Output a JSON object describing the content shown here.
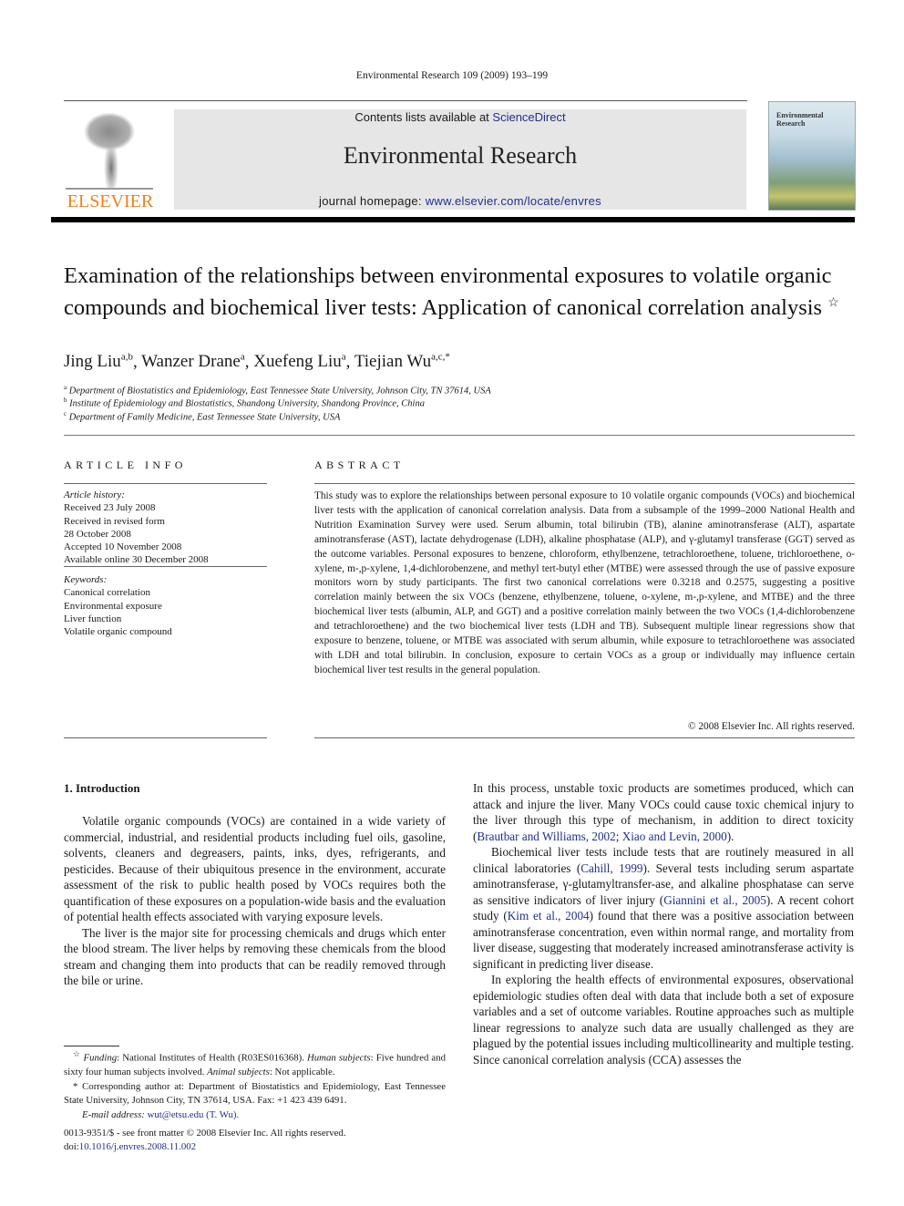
{
  "running_head": "Environmental Research 109 (2009) 193–199",
  "masthead": {
    "publisher_logo_text": "ELSEVIER",
    "contents_prefix": "Contents lists available at ",
    "contents_link": "ScienceDirect",
    "journal_title": "Environmental Research",
    "homepage_prefix": "journal homepage: ",
    "homepage_link": "www.elsevier.com/locate/envres",
    "cover_title_line1": "Environmental",
    "cover_title_line2": "Research",
    "colors": {
      "logo_orange": "#f07f1a",
      "masthead_bg": "#e6e6e6",
      "link": "#1f2f8f"
    }
  },
  "article": {
    "title": "Examination of the relationships between environmental exposures to volatile organic compounds and biochemical liver tests: Application of canonical correlation analysis",
    "title_note_mark": "☆",
    "authors": [
      {
        "name": "Jing Liu",
        "aff": "a,b",
        "sep": ", "
      },
      {
        "name": "Wanzer Drane",
        "aff": "a",
        "sep": ", "
      },
      {
        "name": "Xuefeng Liu",
        "aff": "a",
        "sep": ", "
      },
      {
        "name": "Tiejian Wu",
        "aff": "a,c,*",
        "sep": ""
      }
    ],
    "affiliations": [
      {
        "mark": "a",
        "text": "Department of Biostatistics and Epidemiology, East Tennessee State University, Johnson City, TN 37614, USA"
      },
      {
        "mark": "b",
        "text": "Institute of Epidemiology and Biostatistics, Shandong University, Shandong Province, China"
      },
      {
        "mark": "c",
        "text": "Department of Family Medicine, East Tennessee State University, USA"
      }
    ]
  },
  "article_info": {
    "heading": "ARTICLE INFO",
    "history_label": "Article history:",
    "history": [
      "Received 23 July 2008",
      "Received in revised form",
      "28 October 2008",
      "Accepted 10 November 2008",
      "Available online 30 December 2008"
    ],
    "keywords_label": "Keywords:",
    "keywords": [
      "Canonical correlation",
      "Environmental exposure",
      "Liver function",
      "Volatile organic compound"
    ]
  },
  "abstract": {
    "heading": "ABSTRACT",
    "text": "This study was to explore the relationships between personal exposure to 10 volatile organic compounds (VOCs) and biochemical liver tests with the application of canonical correlation analysis. Data from a subsample of the 1999–2000 National Health and Nutrition Examination Survey were used. Serum albumin, total bilirubin (TB), alanine aminotransferase (ALT), aspartate aminotransferase (AST), lactate dehydrogenase (LDH), alkaline phosphatase (ALP), and γ-glutamyl transferase (GGT) served as the outcome variables. Personal exposures to benzene, chloroform, ethylbenzene, tetrachloroethene, toluene, trichloroethene, o-xylene, m-,p-xylene, 1,4-dichlorobenzene, and methyl tert-butyl ether (MTBE) were assessed through the use of passive exposure monitors worn by study participants. The first two canonical correlations were 0.3218 and 0.2575, suggesting a positive correlation mainly between the six VOCs (benzene, ethylbenzene, toluene, o-xylene, m-,p-xylene, and MTBE) and the three biochemical liver tests (albumin, ALP, and GGT) and a positive correlation mainly between the two VOCs (1,4-dichlorobenzene and tetrachloroethene) and the two biochemical liver tests (LDH and TB). Subsequent multiple linear regressions show that exposure to benzene, toluene, or MTBE was associated with serum albumin, while exposure to tetrachloroethene was associated with LDH and total bilirubin. In conclusion, exposure to certain VOCs as a group or individually may influence certain biochemical liver test results in the general population.",
    "copyright": "© 2008 Elsevier Inc. All rights reserved."
  },
  "introduction": {
    "heading": "1.  Introduction",
    "left_paragraphs": [
      "Volatile organic compounds (VOCs) are contained in a wide variety of commercial, industrial, and residential products including fuel oils, gasoline, solvents, cleaners and degreasers, paints, inks, dyes, refrigerants, and pesticides. Because of their ubiquitous presence in the environment, accurate assessment of the risk to public health posed by VOCs requires both the quantification of these exposures on a population-wide basis and the evaluation of potential health effects associated with varying exposure levels.",
      "The liver is the major site for processing chemicals and drugs which enter the blood stream. The liver helps by removing these chemicals from the blood stream and changing them into products that can be readily removed through the bile or urine."
    ],
    "right": {
      "p1_text": "In this process, unstable toxic products are sometimes produced, which can attack and injure the liver. Many VOCs could cause toxic chemical injury to the liver through this type of mechanism, in addition to direct toxicity (",
      "p1_cite1": "Brautbar and Williams, 2002",
      "p1_sep": "; ",
      "p1_cite2": "Xiao and Levin, 2000",
      "p1_end": ").",
      "p2_a": "Biochemical liver tests include tests that are routinely measured in all clinical laboratories (",
      "p2_cite1": "Cahill, 1999",
      "p2_b": "). Several tests including serum aspartate aminotransferase, γ-glutamyltransfer-ase, and alkaline phosphatase can serve as sensitive indicators of liver injury (",
      "p2_cite2": "Giannini et al., 2005",
      "p2_c": "). A recent cohort study (",
      "p2_cite3": "Kim et al., 2004",
      "p2_d": ") found that there was a positive association between aminotransferase concentration, even within normal range, and mortality from liver disease, suggesting that moderately increased aminotransferase activity is significant in predicting liver disease.",
      "p3": "In exploring the health effects of environmental exposures, observational epidemiologic studies often deal with data that include both a set of exposure variables and a set of outcome variables. Routine approaches such as multiple linear regressions to analyze such data are usually challenged as they are plagued by the potential issues including multicollinearity and multiple testing. Since canonical correlation analysis (CCA) assesses the"
    }
  },
  "footnotes": {
    "funding_mark": "☆",
    "funding_label": "Funding",
    "funding_text": ": National Institutes of Health (R03ES016368). ",
    "human_label": "Human subjects",
    "human_text": ": Five hundred and sixty four human subjects involved. ",
    "animal_label": "Animal subjects",
    "animal_text": ": Not applicable.",
    "corresponding": "* Corresponding author at: Department of Biostatistics and Epidemiology, East Tennessee State University, Johnson City, TN 37614, USA. Fax: +1 423 439 6491.",
    "email_label": "E-mail address: ",
    "email_link": "wut@etsu.edu (T. Wu).",
    "front_matter": "0013-9351/$ - see front matter © 2008 Elsevier Inc. All rights reserved.",
    "doi_prefix": "doi:",
    "doi_link": "10.1016/j.envres.2008.11.002"
  }
}
